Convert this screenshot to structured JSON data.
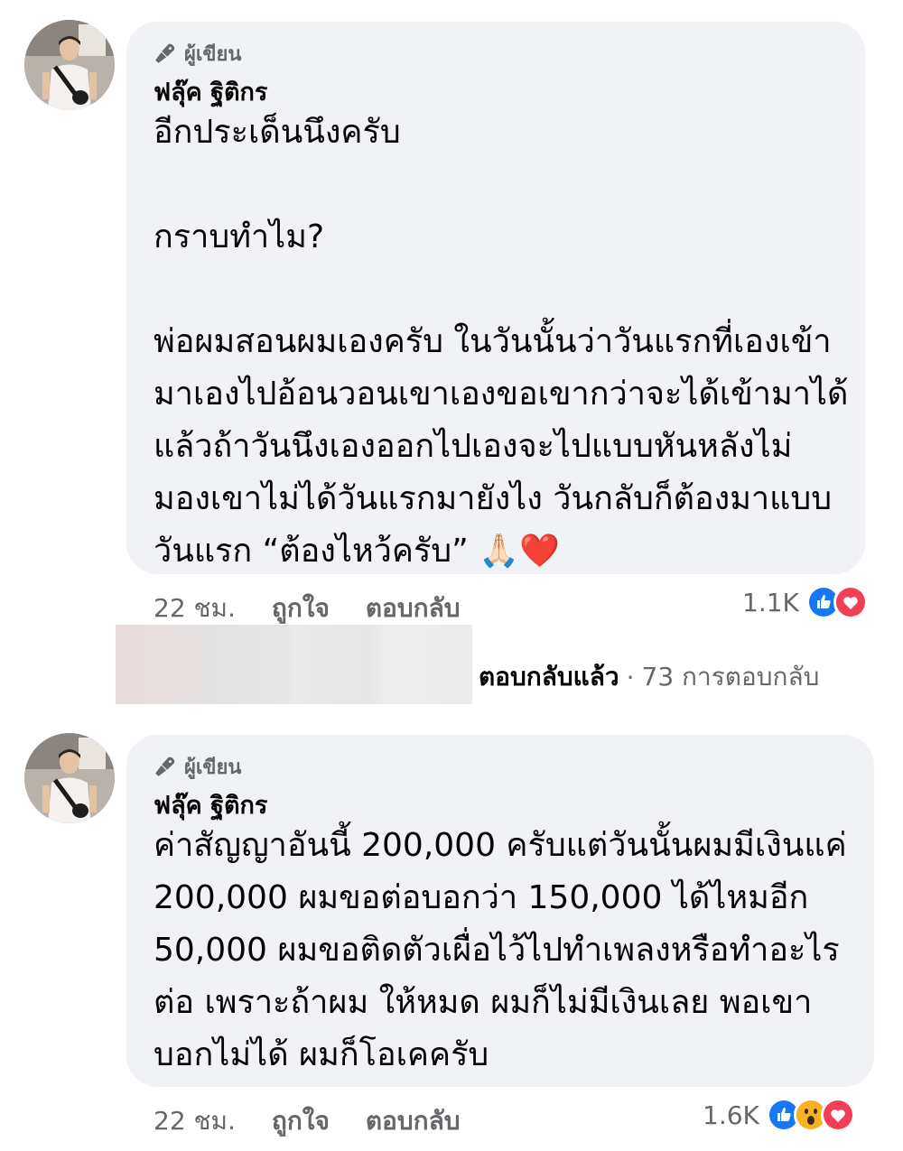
{
  "comments": [
    {
      "author_badge": "ผู้เขียน",
      "author_name": "ฟลุ๊ค ฐิติกร",
      "body_lines": [
        "อีกประเด็นนึงครับ",
        "",
        "กราบทำไม?",
        "",
        " พ่อผมสอนผมเองครับ ในวันนั้นว่าวันแรกที่เองเข้า",
        "มาเองไปอ้อนวอนเขาเองขอเขากว่าจะได้เข้ามาได้",
        "แล้วถ้าวันนึงเองออกไปเองจะไปแบบหันหลังไม่",
        "มองเขาไม่ได้วันแรกมายังไง วันกลับก็ต้องมาแบบ",
        "วันแรก “ต้องไหว้ครับ” 🙏🏻❤️"
      ],
      "time": "22 ชม.",
      "like_label": "ถูกใจ",
      "reply_label": "ตอบกลับ",
      "reaction_count": "1.1K",
      "reaction_icons": [
        "like-icon",
        "love-icon"
      ]
    },
    {
      "author_badge": "ผู้เขียน",
      "author_name": "ฟลุ๊ค ฐิติกร",
      "body_lines": [
        "ค่าสัญญาอันนี้ 200,000 ครับแต่วันนั้นผมมีเงินแค่",
        "200,000 ผมขอต่อบอกว่า 150,000 ได้ไหมอีก",
        "50,000 ผมขอติดตัวเผื่อไว้ไปทำเพลงหรือทำอะไร",
        "ต่อ เพราะถ้าผม ให้หมด ผมก็ไม่มีเงินเลย พอเขา",
        "บอกไม่ได้ ผมก็โอเคครับ"
      ],
      "time": "22 ชม.",
      "like_label": "ถูกใจ",
      "reply_label": "ตอบกลับ",
      "reaction_count": "1.6K",
      "reaction_icons": [
        "like-icon",
        "wow-icon",
        "love-icon"
      ]
    }
  ],
  "replies_summary": {
    "replied_label": "ตอบกลับแล้ว",
    "separator": "·",
    "count_label": "73 การตอบกลับ"
  },
  "colors": {
    "bubble_bg": "#f0f2f5",
    "secondary_text": "#65676b",
    "like_blue": "#1877f2",
    "love_red": "#f33e58",
    "wow_yellow": "#f7b125"
  }
}
